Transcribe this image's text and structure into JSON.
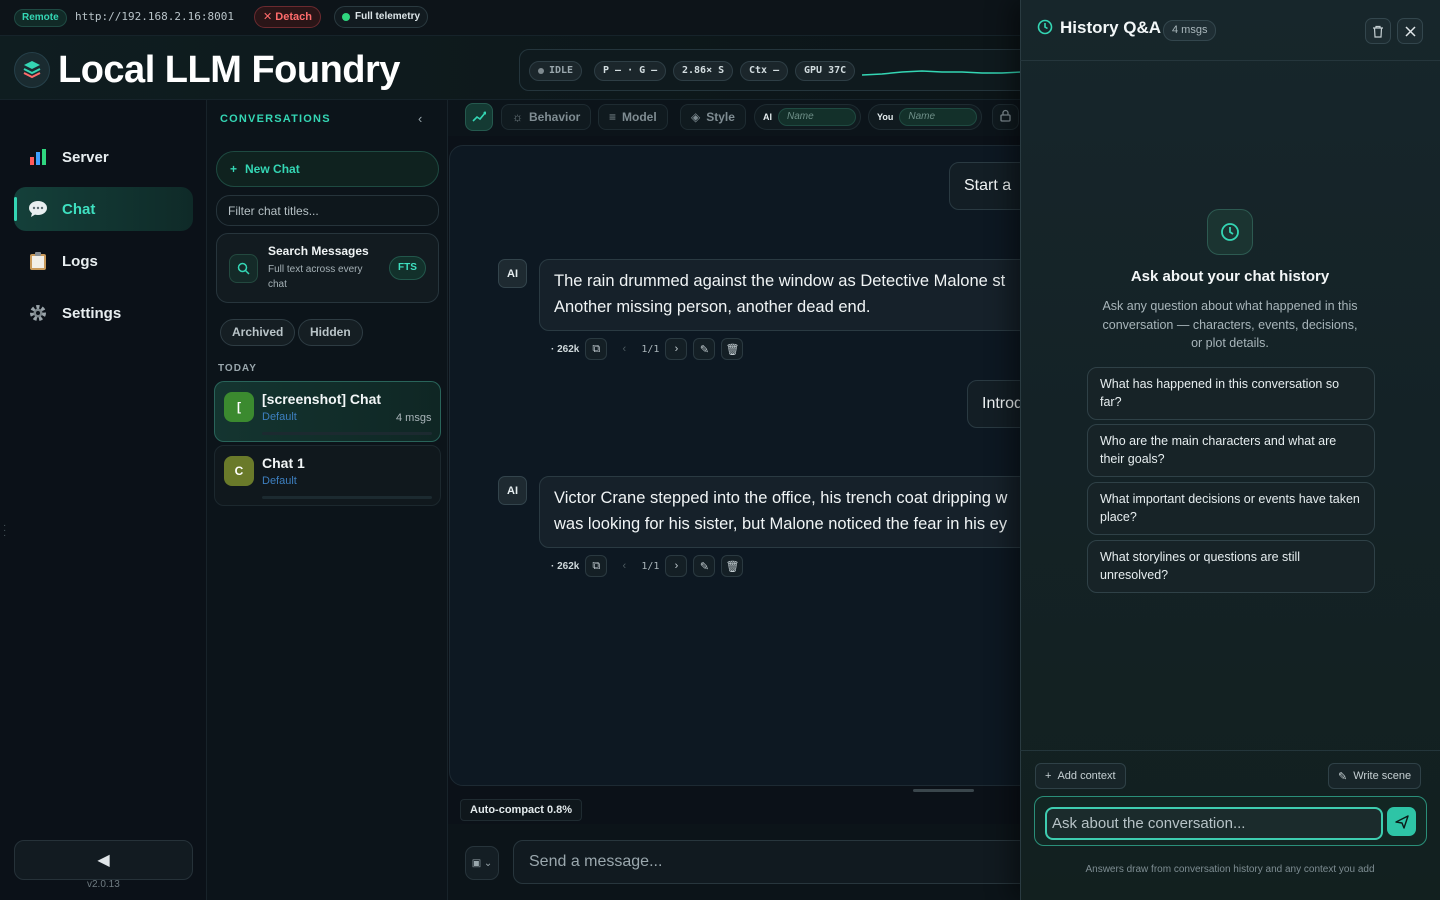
{
  "topbar": {
    "remote_label": "Remote",
    "address": "http://192.168.2.16:8001",
    "detach_label": "Detach",
    "telemetry_label": "Full telemetry"
  },
  "header": {
    "brand": "Local LLM Foundry",
    "status": {
      "state": "IDLE",
      "pg": "P — · G —",
      "speed": "2.86× S",
      "ctx": "Ctx —",
      "gpu": "GPU 37C"
    }
  },
  "nav": {
    "items": [
      {
        "label": "Server",
        "icon": "bar-chart-icon"
      },
      {
        "label": "Chat",
        "icon": "speech-bubble-icon",
        "active": true
      },
      {
        "label": "Logs",
        "icon": "clipboard-icon"
      },
      {
        "label": "Settings",
        "icon": "gear-icon"
      }
    ],
    "version": "v2.0.13"
  },
  "conversations": {
    "heading": "CONVERSATIONS",
    "new_chat_label": "New Chat",
    "filter_placeholder": "Filter chat titles...",
    "search": {
      "title": "Search Messages",
      "desc": "Full text across every chat",
      "badge": "FTS"
    },
    "archived_label": "Archived",
    "hidden_label": "Hidden",
    "today_label": "TODAY",
    "chats": [
      {
        "initial": "[",
        "title": "[screenshot] Chat",
        "persona": "Default",
        "msgs": "4 msgs"
      },
      {
        "initial": "C",
        "title": "Chat 1",
        "persona": "Default",
        "msgs": ""
      }
    ]
  },
  "toolbar": {
    "behavior_label": "Behavior",
    "model_label": "Model",
    "style_label": "Style",
    "ai_label": "AI",
    "ai_name_placeholder": "Name",
    "you_label": "You",
    "you_name_placeholder": "Name"
  },
  "messages": [
    {
      "role": "user",
      "text": "Start a"
    },
    {
      "role": "ai",
      "badge": "AI",
      "line1": "The rain drummed against the window as Detective Malone st",
      "line2": "Another missing person, another dead end.",
      "tokens": "262k",
      "page": "1/1"
    },
    {
      "role": "user",
      "text": "Introd"
    },
    {
      "role": "ai",
      "badge": "AI",
      "line1": "Victor Crane stepped into the office, his trench coat dripping w",
      "line2": "was looking for his sister, but Malone noticed the fear in his ey",
      "tokens": "262k",
      "page": "1/1"
    }
  ],
  "composer": {
    "auto_compact": "Auto-compact 0.8%",
    "placeholder": "Send a message..."
  },
  "history_qa": {
    "title": "History Q&A",
    "count": "4 msgs",
    "hero_title": "Ask about your chat history",
    "hero_desc": "Ask any question about what happened in this conversation — characters, events, decisions, or plot details.",
    "suggestions": [
      "What has happened in this conversation so far?",
      "Who are the main characters and what are their goals?",
      "What important decisions or events have taken place?",
      "What storylines or questions are still unresolved?"
    ],
    "add_context_label": "Add context",
    "write_scene_label": "Write scene",
    "input_placeholder": "Ask about the conversation...",
    "footnote": "Answers draw from conversation history and any context you add"
  },
  "colors": {
    "accent": "#34d6b4",
    "danger": "#ff6b6b",
    "background": "#0b1118"
  }
}
